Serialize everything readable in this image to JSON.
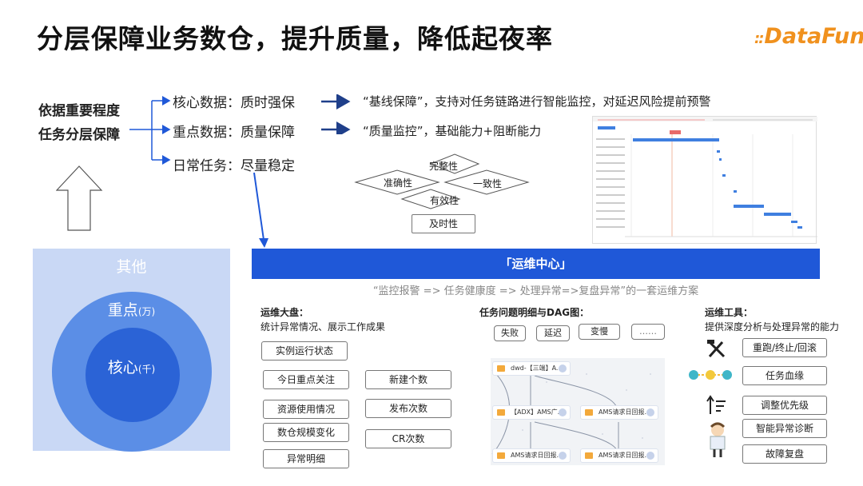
{
  "title": "分层保障业务数仓，提升质量，降低起夜率",
  "logo": {
    "dots": "::",
    "text": "DataFun."
  },
  "left_heading": {
    "line1": "依据重要程度",
    "line2": "任务分层保障"
  },
  "levels": [
    {
      "label": "核心数据：质时强保",
      "desc": "“基线保障”，支持对任务链路进行智能监控，对延迟风险提前预警"
    },
    {
      "label": "重点数据：质量保障",
      "desc": "“质量监控”，基础能力+阻断能力"
    },
    {
      "label": "日常任务：尽量稳定"
    }
  ],
  "quality_dimensions": {
    "top": "完整性",
    "left": "准确性",
    "right": "一致性",
    "bottom": "有效性",
    "extra": "及时性"
  },
  "pyramid": {
    "outer": "其他",
    "middle": "重点",
    "middle_unit": "(万)",
    "inner": "核心",
    "inner_unit": "(千)"
  },
  "banner": "「运维中心」",
  "banner_sub": "“监控报警 => 任务健康度 => 处理异常=>复盘异常”的一套运维方案",
  "dashboard": {
    "title": "运维大盘：",
    "subtitle": "统计异常情况、展示工作成果",
    "col1": [
      "实例运行状态",
      "今日重点关注",
      "资源使用情况",
      "数仓规模变化",
      "异常明细"
    ],
    "col2": [
      "新建个数",
      "发布次数",
      "CR次数"
    ]
  },
  "problems": {
    "title": "任务问题明细与DAG图：",
    "tags": [
      "失败",
      "延迟",
      "变慢",
      "……"
    ],
    "dag_nodes": [
      "dwd-【三端】A...",
      "【ADX】AMS广...",
      "AMS请求日回报...",
      "AMS请求日回报...",
      "AMS请求日回报..."
    ]
  },
  "tools": {
    "title": "运维工具：",
    "subtitle": "提供深度分析与处理异常的能力",
    "items": [
      {
        "label": "重跑/终止/回滚",
        "icon": "tools-icon"
      },
      {
        "label": "任务血缘",
        "icon": "lineage-icon"
      },
      {
        "label": "调整优先级",
        "icon": "priority-icon"
      },
      {
        "label": "智能异常诊断",
        "icon": "doctor-icon"
      },
      {
        "label": "故障复盘",
        "icon": "review-icon"
      }
    ]
  },
  "colors": {
    "accent": "#1f58d8",
    "outer": "#c9d8f5",
    "middle": "#5b8ee6",
    "inner": "#2b63d6",
    "logo": "#f0911e"
  }
}
